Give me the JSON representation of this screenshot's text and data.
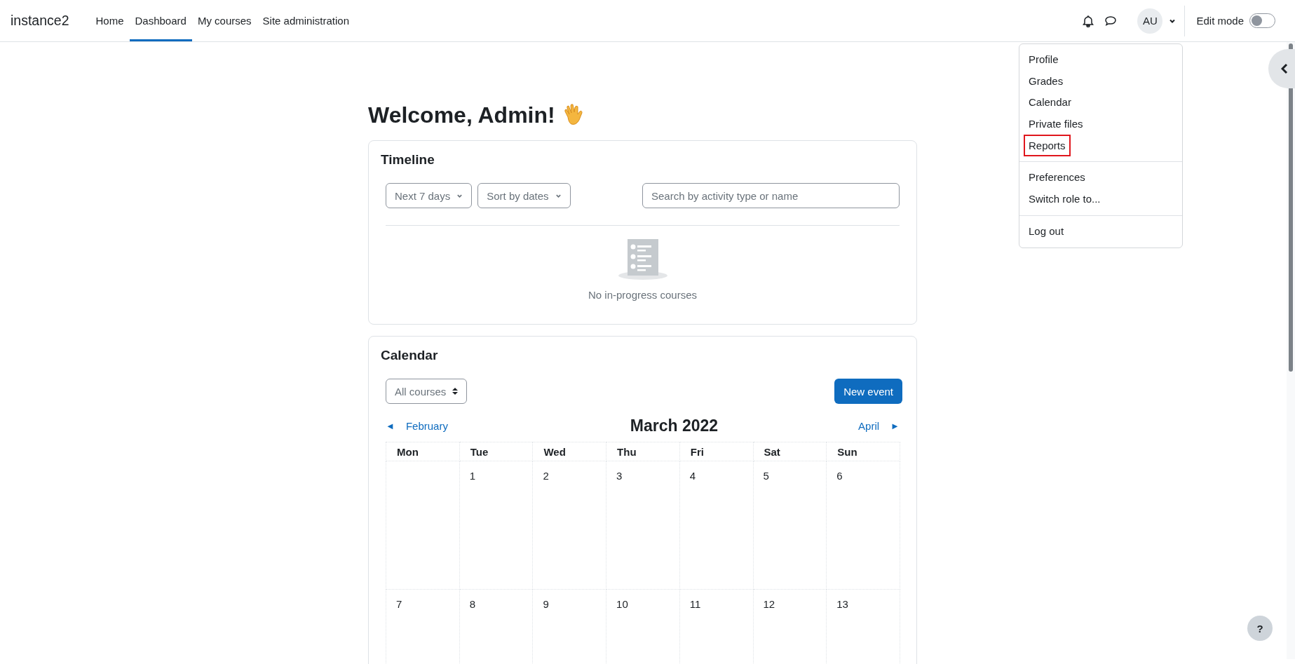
{
  "brand": "instance2",
  "nav": [
    {
      "label": "Home",
      "selected": false
    },
    {
      "label": "Dashboard",
      "selected": true
    },
    {
      "label": "My courses",
      "selected": false
    },
    {
      "label": "Site administration",
      "selected": false
    }
  ],
  "avatar": "AU",
  "edit_mode": {
    "label": "Edit mode",
    "on": false
  },
  "user_menu": {
    "groups": [
      {
        "items": [
          {
            "label": "Profile",
            "highlighted": false
          },
          {
            "label": "Grades",
            "highlighted": false
          },
          {
            "label": "Calendar",
            "highlighted": false
          },
          {
            "label": "Private files",
            "highlighted": false
          },
          {
            "label": "Reports",
            "highlighted": true
          }
        ]
      },
      {
        "items": [
          {
            "label": "Preferences",
            "highlighted": false
          },
          {
            "label": "Switch role to...",
            "highlighted": false
          }
        ]
      },
      {
        "items": [
          {
            "label": "Log out",
            "highlighted": false
          }
        ]
      }
    ]
  },
  "welcome": "Welcome, Admin!",
  "timeline": {
    "title": "Timeline",
    "filters": [
      "Next 7 days",
      "Sort by dates"
    ],
    "search": {
      "placeholder": "Search by activity type or name"
    },
    "empty_text": "No in-progress courses"
  },
  "calendar": {
    "title": "Calendar",
    "course_filter": "All courses",
    "new_event": "New event",
    "prev": {
      "arrow": "◄",
      "label": "February"
    },
    "month": "March 2022",
    "next": {
      "label": "April",
      "arrow": "►"
    },
    "weekdays": [
      "Mon",
      "Tue",
      "Wed",
      "Thu",
      "Fri",
      "Sat",
      "Sun"
    ],
    "weeks": [
      [
        "1",
        "2",
        "3",
        "4",
        "5",
        "6"
      ],
      [
        "7",
        "8",
        "9",
        "10",
        "11",
        "12",
        "13"
      ]
    ]
  },
  "help_button": "?"
}
